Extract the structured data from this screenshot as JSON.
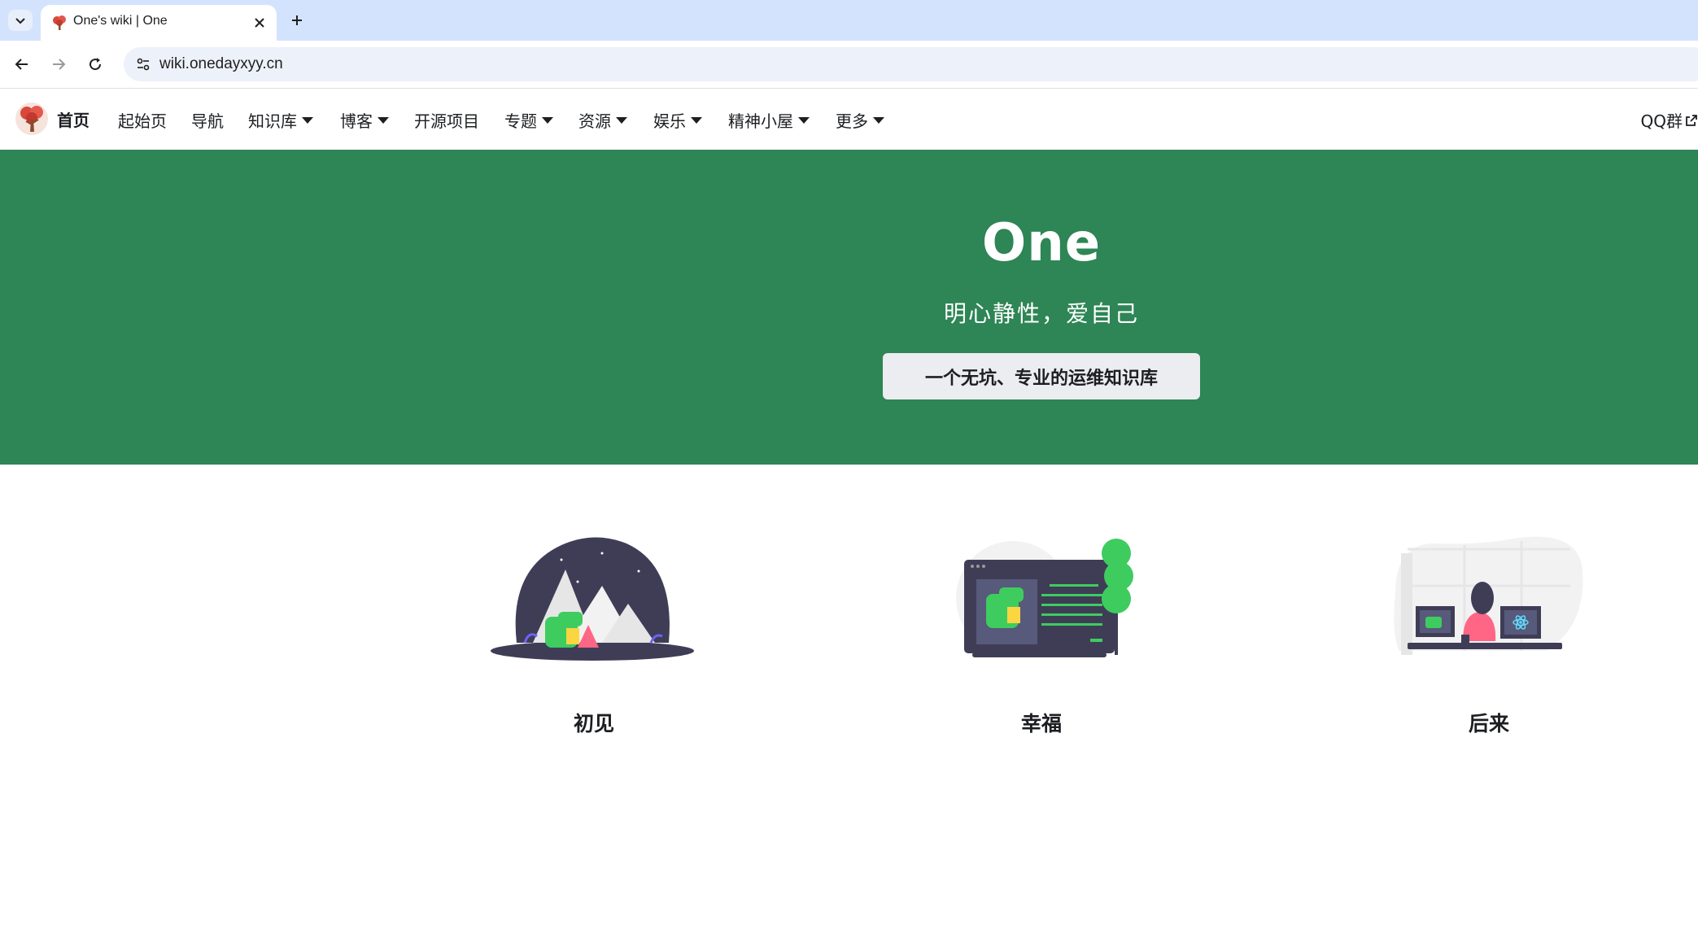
{
  "browser": {
    "tab_title": "One's wiki | One",
    "url": "wiki.onedayxyy.cn"
  },
  "navbar": {
    "brand": "首页",
    "items": [
      {
        "label": "起始页",
        "dropdown": false
      },
      {
        "label": "导航",
        "dropdown": false
      },
      {
        "label": "知识库",
        "dropdown": true
      },
      {
        "label": "博客",
        "dropdown": true
      },
      {
        "label": "开源项目",
        "dropdown": false
      },
      {
        "label": "专题",
        "dropdown": true
      },
      {
        "label": "资源",
        "dropdown": true
      },
      {
        "label": "娱乐",
        "dropdown": true
      },
      {
        "label": "精神小屋",
        "dropdown": true
      },
      {
        "label": "更多",
        "dropdown": true
      }
    ],
    "right_link": "QQ群"
  },
  "hero": {
    "title": "One",
    "subtitle": "明心静性，爱自己",
    "button": "一个无坑、专业的运维知识库"
  },
  "features": [
    {
      "title": "初见",
      "icon": "mountain-dino-illustration"
    },
    {
      "title": "幸福",
      "icon": "monitor-dino-illustration"
    },
    {
      "title": "后来",
      "icon": "desk-react-illustration"
    }
  ],
  "colors": {
    "primary": "#2e8555",
    "tabstrip": "#d3e3fd",
    "button_bg": "#ebedf0"
  }
}
